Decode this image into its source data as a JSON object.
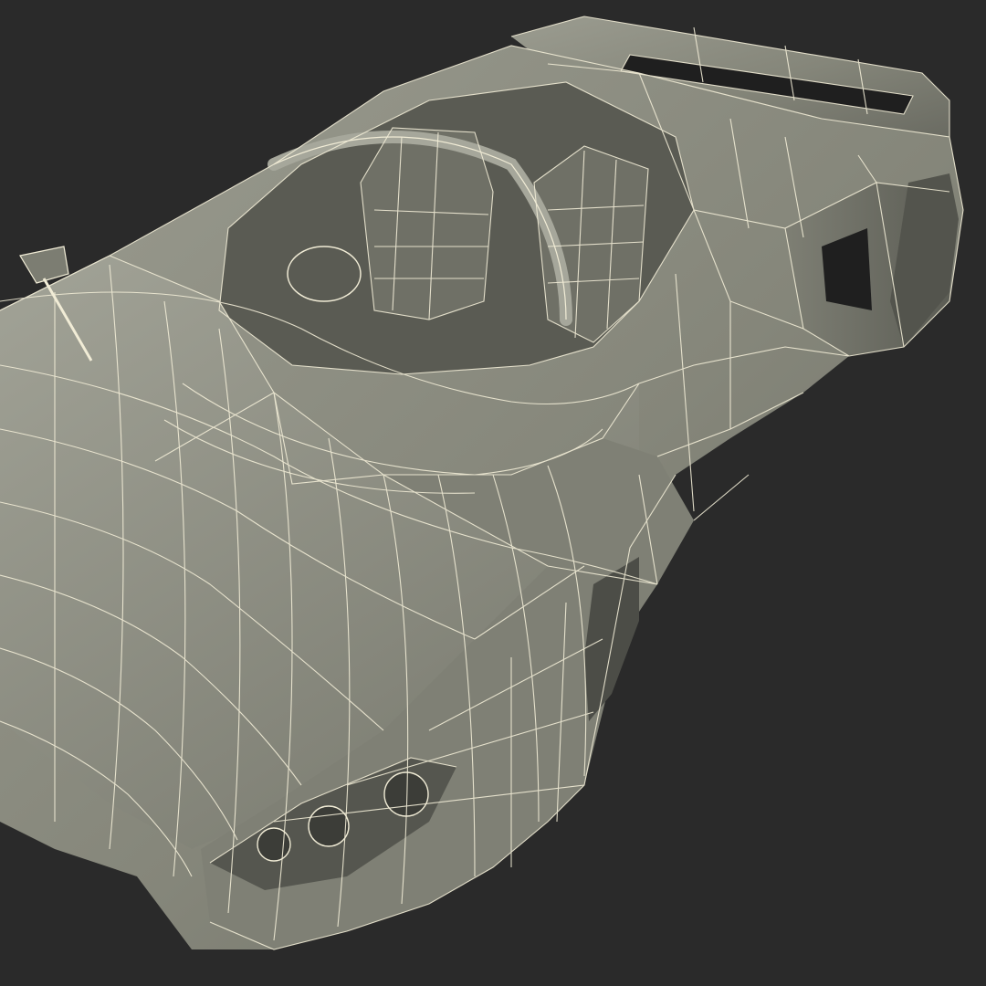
{
  "scene": {
    "subject": "car-wireframe-render",
    "background_color": "#2a2a2a",
    "body_color": "#8d8e82",
    "body_shadow_color": "#5e5f57",
    "body_highlight_color": "#a6a79b",
    "wire_color": "#f1ecd6",
    "opening_color": "#1f1f1f"
  }
}
